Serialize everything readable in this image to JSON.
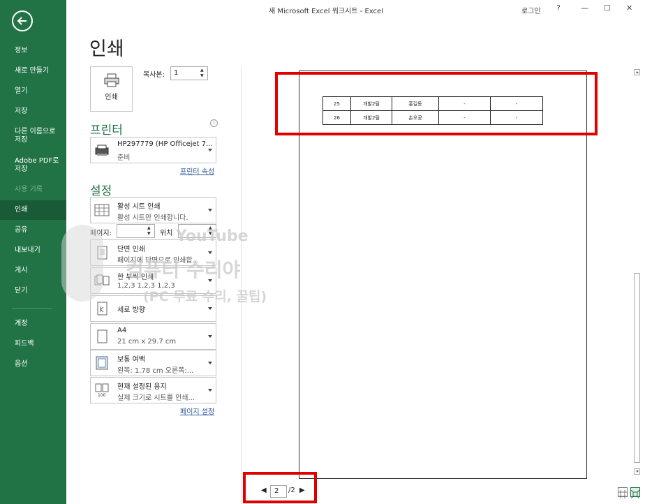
{
  "window": {
    "title": "새 Microsoft Excel 워크시트  -  Excel",
    "signin": "로그인",
    "help": "?",
    "minimize": "—",
    "restore": "☐",
    "close": "✕"
  },
  "sidebar": {
    "items": [
      {
        "label": "정보"
      },
      {
        "label": "새로 만들기"
      },
      {
        "label": "열기"
      },
      {
        "label": "저장"
      },
      {
        "label": "다른 이름으로 저장"
      },
      {
        "label": "Adobe PDF로 저장"
      },
      {
        "label": "사용 기록"
      },
      {
        "label": "인쇄"
      },
      {
        "label": "공유"
      },
      {
        "label": "내보내기"
      },
      {
        "label": "게시"
      },
      {
        "label": "닫기"
      },
      {
        "label": "계정"
      },
      {
        "label": "피드백"
      },
      {
        "label": "옵션"
      }
    ]
  },
  "main": {
    "title": "인쇄",
    "print_button": "인쇄",
    "copies_label": "복사본:",
    "copies_value": "1",
    "printer_heading": "프린터",
    "printer_name": "HP297779 (HP Officejet 7...",
    "printer_status": "준비",
    "printer_props_link": "프린터 속성",
    "settings_heading": "설정",
    "settings": [
      {
        "line1": "활성 시트 인쇄",
        "line2": "활성 시트만 인쇄합니다."
      },
      {
        "line1": "단면 인쇄",
        "line2": "페이지에 단면으로 인쇄합..."
      },
      {
        "line1": "한 부씩 인쇄",
        "line2": "1,2,3     1,2,3     1,2,3"
      },
      {
        "line1": "세로 방향",
        "line2": ""
      },
      {
        "line1": "A4",
        "line2": "21 cm x 29.7 cm"
      },
      {
        "line1": "보통 여백",
        "line2": "왼쪽:  1.78 cm     오른쪽:..."
      },
      {
        "line1": "현재 설정된 용지",
        "line2": "실제 크기로 시트를 인쇄..."
      }
    ],
    "pages_label": "페이지:",
    "to_label": "위치",
    "page_setup_link": "페이지 설정"
  },
  "preview": {
    "rows": [
      [
        "25",
        "개발2팀",
        "홍길동",
        "-",
        "-"
      ],
      [
        "26",
        "개발2팀",
        "손오공",
        "-",
        "-"
      ]
    ],
    "current_page": "2",
    "total_pages": "/2"
  },
  "watermark": {
    "line1": "YouTube",
    "line2": "컴퓨터 수리야",
    "line3": "(PC 무료 수리, 꿀팁)"
  },
  "colors": {
    "accent": "#217346",
    "highlight": "#e00000"
  }
}
